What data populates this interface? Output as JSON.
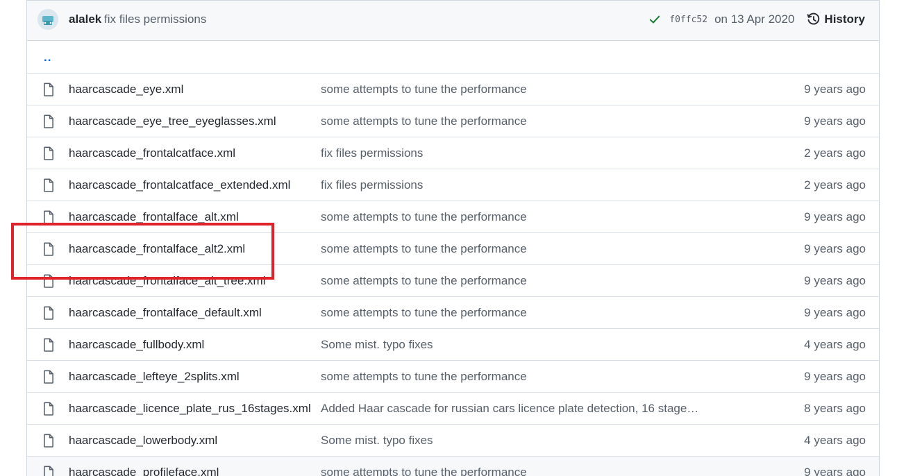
{
  "commit": {
    "author": "alalek",
    "message": "fix files permissions",
    "sha": "f0ffc52",
    "date": "on 13 Apr 2020",
    "history_label": "History",
    "status_color": "#1a7f37"
  },
  "parent_link": "..",
  "files": [
    {
      "name": "haarcascade_eye.xml",
      "message": "some attempts to tune the performance",
      "age": "9 years ago"
    },
    {
      "name": "haarcascade_eye_tree_eyeglasses.xml",
      "message": "some attempts to tune the performance",
      "age": "9 years ago"
    },
    {
      "name": "haarcascade_frontalcatface.xml",
      "message": "fix files permissions",
      "age": "2 years ago"
    },
    {
      "name": "haarcascade_frontalcatface_extended.xml",
      "message": "fix files permissions",
      "age": "2 years ago"
    },
    {
      "name": "haarcascade_frontalface_alt.xml",
      "message": "some attempts to tune the performance",
      "age": "9 years ago"
    },
    {
      "name": "haarcascade_frontalface_alt2.xml",
      "message": "some attempts to tune the performance",
      "age": "9 years ago"
    },
    {
      "name": "haarcascade_frontalface_alt_tree.xml",
      "message": "some attempts to tune the performance",
      "age": "9 years ago"
    },
    {
      "name": "haarcascade_frontalface_default.xml",
      "message": "some attempts to tune the performance",
      "age": "9 years ago"
    },
    {
      "name": "haarcascade_fullbody.xml",
      "message": "Some mist. typo fixes",
      "age": "4 years ago"
    },
    {
      "name": "haarcascade_lefteye_2splits.xml",
      "message": "some attempts to tune the performance",
      "age": "9 years ago"
    },
    {
      "name": "haarcascade_licence_plate_rus_16stages.xml",
      "message": "Added Haar cascade for russian cars licence plate detection, 16 stage…",
      "age": "8 years ago"
    },
    {
      "name": "haarcascade_lowerbody.xml",
      "message": "Some mist. typo fixes",
      "age": "4 years ago"
    },
    {
      "name": "haarcascade_profileface.xml",
      "message": "some attempts to tune the performance",
      "age": "9 years ago"
    }
  ],
  "highlight": {
    "target": "haarcascade_frontalface_alt2.xml",
    "color": "#e0232a"
  }
}
